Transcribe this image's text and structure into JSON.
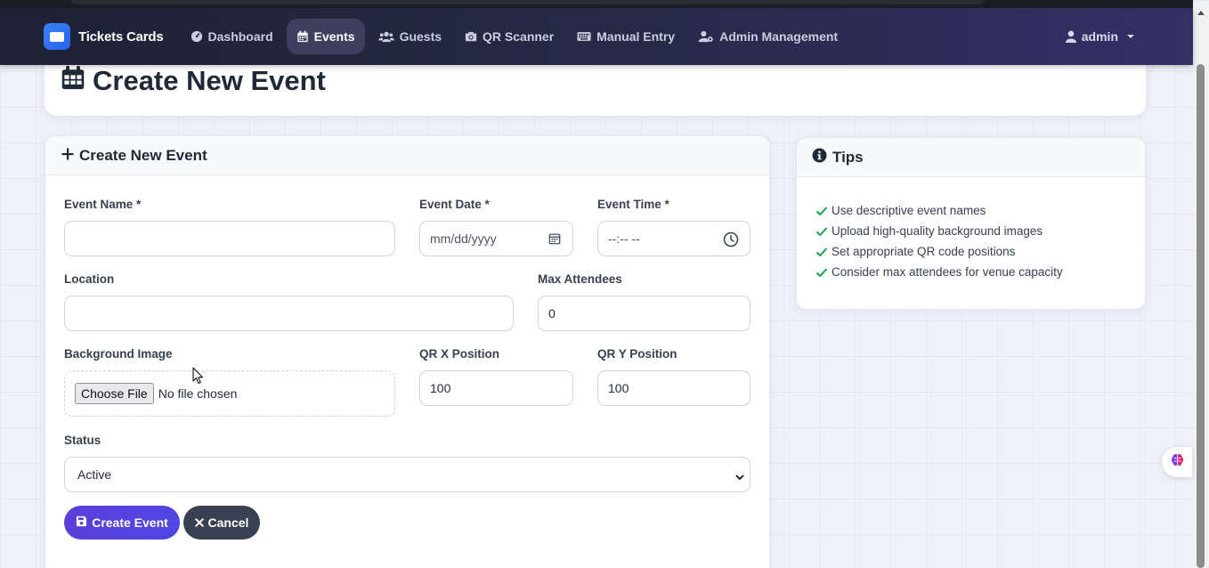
{
  "colors": {
    "accent": "#4f46e5",
    "navbar": "#262a48",
    "success": "#16a34a",
    "secondary_button": "#374151"
  },
  "nav": {
    "brand": "Tickets Cards",
    "items": [
      {
        "label": "Dashboard",
        "icon": "gauge-icon"
      },
      {
        "label": "Events",
        "icon": "calendar-icon",
        "active": true
      },
      {
        "label": "Guests",
        "icon": "users-icon"
      },
      {
        "label": "QR Scanner",
        "icon": "camera-icon"
      },
      {
        "label": "Manual Entry",
        "icon": "keyboard-icon"
      },
      {
        "label": "Admin Management",
        "icon": "user-gear-icon"
      }
    ],
    "user": "admin"
  },
  "page": {
    "title": "Create New Event"
  },
  "form": {
    "header": "Create New Event",
    "event_name": {
      "label": "Event Name *",
      "value": ""
    },
    "event_date": {
      "label": "Event Date *",
      "placeholder": "mm/dd/yyyy"
    },
    "event_time": {
      "label": "Event Time *",
      "placeholder": "--:-- --"
    },
    "location": {
      "label": "Location",
      "value": ""
    },
    "max_attendees": {
      "label": "Max Attendees",
      "value": "0"
    },
    "background_image": {
      "label": "Background Image",
      "button": "Choose File",
      "status": "No file chosen"
    },
    "qr_x": {
      "label": "QR X Position",
      "value": "100"
    },
    "qr_y": {
      "label": "QR Y Position",
      "value": "100"
    },
    "status": {
      "label": "Status",
      "value": "Active"
    },
    "submit_label": "Create Event",
    "cancel_label": "Cancel"
  },
  "tips": {
    "header": "Tips",
    "items": [
      "Use descriptive event names",
      "Upload high-quality background images",
      "Set appropriate QR code positions",
      "Consider max attendees for venue capacity"
    ]
  }
}
